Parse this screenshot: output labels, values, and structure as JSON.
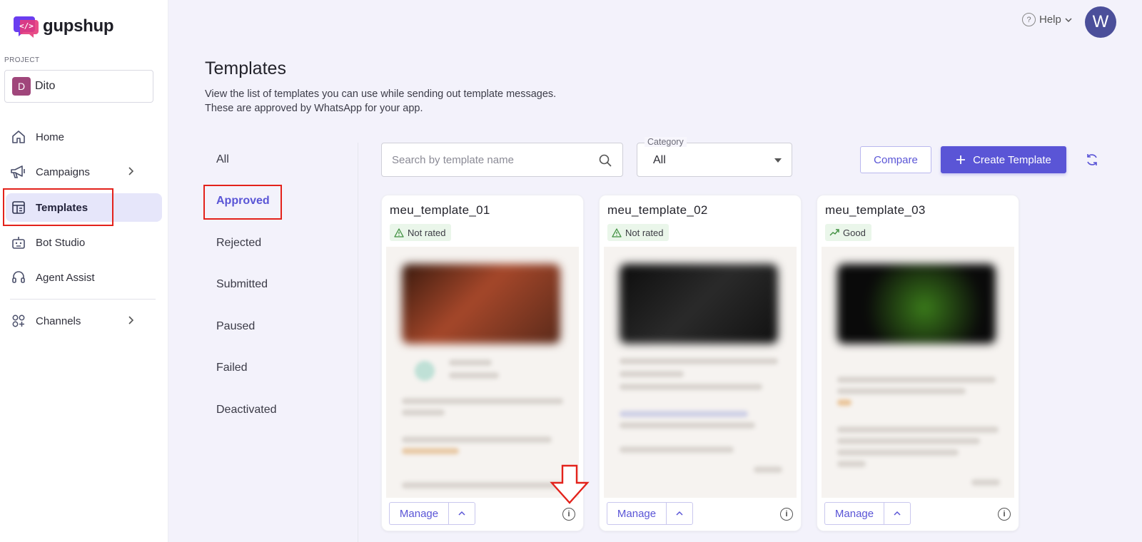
{
  "brand": {
    "name": "gupshup"
  },
  "project": {
    "label": "PROJECT",
    "avatar": "D",
    "name": "Dito"
  },
  "nav": [
    {
      "id": "home",
      "label": "Home",
      "icon": "home-icon",
      "chevron": false,
      "active": false
    },
    {
      "id": "campaigns",
      "label": "Campaigns",
      "icon": "megaphone-icon",
      "chevron": true,
      "active": false
    },
    {
      "id": "templates",
      "label": "Templates",
      "icon": "templates-icon",
      "chevron": false,
      "active": true
    },
    {
      "id": "bot-studio",
      "label": "Bot Studio",
      "icon": "bot-icon",
      "chevron": false,
      "active": false
    },
    {
      "id": "agent-assist",
      "label": "Agent Assist",
      "icon": "headset-icon",
      "chevron": false,
      "active": false
    },
    {
      "id": "channels",
      "label": "Channels",
      "icon": "channels-icon",
      "chevron": true,
      "active": false
    }
  ],
  "topbar": {
    "help": "Help",
    "user_initial": "W"
  },
  "page": {
    "title": "Templates",
    "description_1": "View the list of templates you can use while sending out template messages.",
    "description_2": "These are approved by WhatsApp for your app."
  },
  "status_tabs": [
    "All",
    "Approved",
    "Rejected",
    "Submitted",
    "Paused",
    "Failed",
    "Deactivated"
  ],
  "active_status": "Approved",
  "search": {
    "placeholder": "Search by template name",
    "value": ""
  },
  "category": {
    "label": "Category",
    "value": "All"
  },
  "buttons": {
    "compare": "Compare",
    "create": "Create Template"
  },
  "templates": [
    {
      "name": "meu_template_01",
      "rating": "Not rated",
      "rating_icon": "warning-icon"
    },
    {
      "name": "meu_template_02",
      "rating": "Not rated",
      "rating_icon": "warning-icon"
    },
    {
      "name": "meu_template_03",
      "rating": "Good",
      "rating_icon": "trend-up-icon"
    }
  ],
  "card_actions": {
    "manage": "Manage"
  },
  "colors": {
    "accent": "#5a55d6",
    "annotation": "#e3221b",
    "active_nav_bg": "#e6e6fa"
  }
}
